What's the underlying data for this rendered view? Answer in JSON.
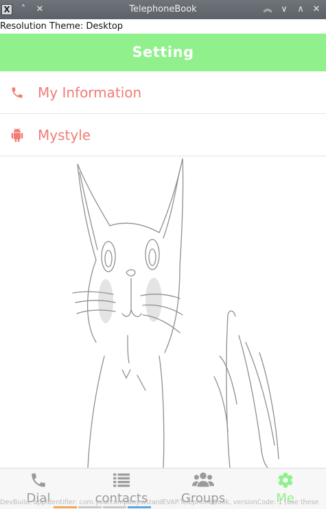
{
  "window": {
    "title": "TelephoneBook",
    "app_icon_glyph": "X"
  },
  "resolution_line": "Resolution Theme: Desktop",
  "header": {
    "title": "Setting"
  },
  "menu": [
    {
      "label": "My Information",
      "icon": "phone-icon"
    },
    {
      "label": "Mystyle",
      "icon": "android-icon"
    }
  ],
  "nav": [
    {
      "label": "Dial",
      "icon": "phone-icon",
      "active": false
    },
    {
      "label": "contacts",
      "icon": "list-icon",
      "active": false
    },
    {
      "label": "Groups",
      "icon": "group-icon",
      "active": false
    },
    {
      "label": "Me",
      "icon": "gear-icon",
      "active": true
    }
  ],
  "dev_overlay": "DevBuild, appIdentifier: com.yourcompany.wizardEVAP.TelephoneBook, versionCode: 1 (use these",
  "colors": {
    "header_bg": "#8ff08c",
    "menu_text": "#f07c74",
    "nav_active": "#8ff08c",
    "nav_inactive": "#9a9a9a"
  }
}
